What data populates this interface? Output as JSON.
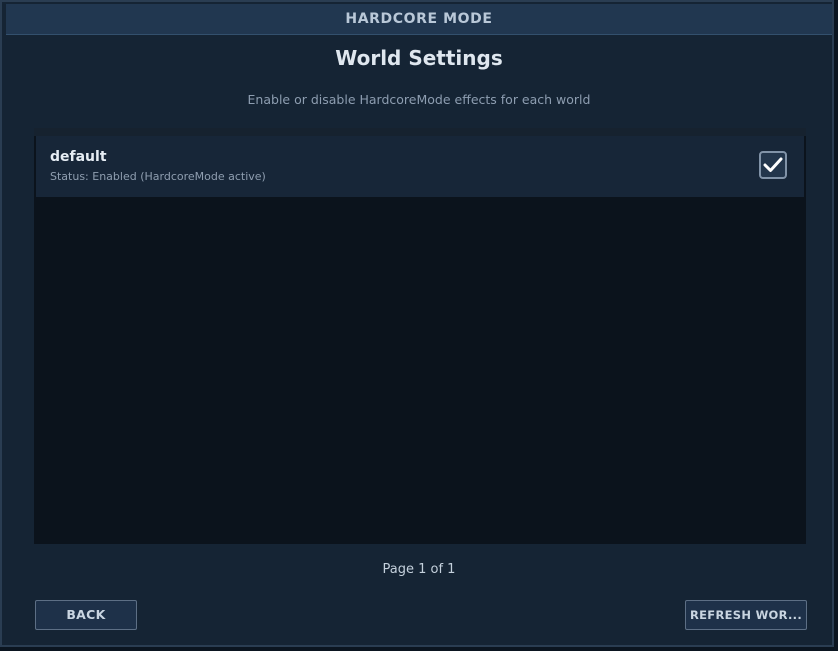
{
  "window": {
    "title": "HARDCORE MODE"
  },
  "main": {
    "heading": "World Settings",
    "subheading": "Enable or disable HardcoreMode effects for each world"
  },
  "worlds": [
    {
      "name": "default",
      "status": "Status: Enabled (HardcoreMode active)",
      "enabled": true
    }
  ],
  "pagination": {
    "text": "Page 1 of 1"
  },
  "buttons": {
    "back_label": "BACK",
    "refresh_label": "REFRESH WOR..."
  },
  "icons": {
    "checkbox_icon": "check-icon"
  },
  "colors": {
    "background": "#152434",
    "titlebar": "#213750",
    "list_panel": "#0b131c",
    "row": "#172638",
    "accent_text": "#dfe7ef"
  }
}
